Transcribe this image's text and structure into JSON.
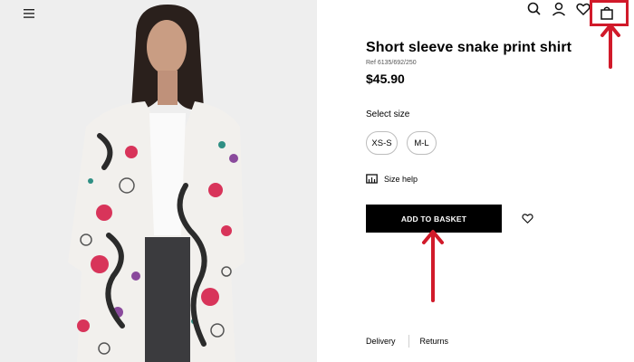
{
  "header": {
    "icons": [
      "menu-icon",
      "search-icon",
      "account-icon",
      "wishlist-heart-icon",
      "shopping-bag-icon"
    ]
  },
  "product": {
    "title": "Short sleeve snake print shirt",
    "ref": "Ref 6135/692/250",
    "price": "$45.90"
  },
  "sizes": {
    "label": "Select size",
    "options": [
      "XS-S",
      "M-L"
    ]
  },
  "size_help": "Size help",
  "add_to_basket": "ADD TO BASKET",
  "tabs": [
    "Delivery",
    "Returns"
  ],
  "annotations": {
    "highlight_color": "#d11a2a"
  },
  "colors": {
    "image_background": "#eeeeee",
    "button": "#000000"
  }
}
